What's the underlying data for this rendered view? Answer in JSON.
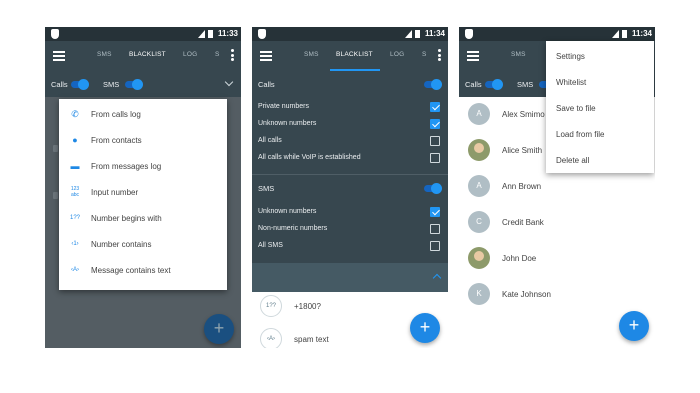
{
  "status": {
    "time1": "11:33",
    "time2": "11:34",
    "time3": "11:34"
  },
  "tabs": {
    "sms": "SMS",
    "blacklist": "BLACKLIST",
    "log": "LOG",
    "s": "S"
  },
  "subbar": {
    "calls": "Calls",
    "sms": "SMS"
  },
  "add_menu": {
    "items": [
      {
        "label": "From calls log",
        "icon": "phone-icon"
      },
      {
        "label": "From contacts",
        "icon": "person-icon"
      },
      {
        "label": "From messages log",
        "icon": "message-icon"
      },
      {
        "label": "Input number",
        "icon": "dialpad-123-icon",
        "glyph": "123\nabc"
      },
      {
        "label": "Number begins with",
        "icon": "number-begins-icon",
        "glyph": "1??"
      },
      {
        "label": "Number contains",
        "icon": "number-contains-icon",
        "glyph": "‹1›"
      },
      {
        "label": "Message contains text",
        "icon": "text-contains-icon",
        "glyph": "‹A›"
      }
    ]
  },
  "settings_panel": {
    "calls_header": "Calls",
    "calls_options": [
      {
        "label": "Private numbers",
        "checked": true
      },
      {
        "label": "Unknown numbers",
        "checked": true
      },
      {
        "label": "All calls",
        "checked": false
      },
      {
        "label": "All calls while VoIP is established",
        "checked": false
      }
    ],
    "sms_header": "SMS",
    "sms_options": [
      {
        "label": "Unknown numbers",
        "checked": true
      },
      {
        "label": "Non-numeric numbers",
        "checked": false
      },
      {
        "label": "All SMS",
        "checked": false
      }
    ]
  },
  "blacklist_entries": [
    {
      "icon_text": "1??",
      "text": "+1800?"
    },
    {
      "icon_text": "‹A›",
      "text": "spam text"
    }
  ],
  "contacts": [
    {
      "initial": "A",
      "name": "Alex Smimo",
      "photo": false
    },
    {
      "initial": "",
      "name": "Alice Smith",
      "photo": true
    },
    {
      "initial": "A",
      "name": "Ann Brown",
      "photo": false
    },
    {
      "initial": "C",
      "name": "Credit Bank",
      "photo": false
    },
    {
      "initial": "",
      "name": "John Doe",
      "photo": true
    },
    {
      "initial": "K",
      "name": "Kate Johnson",
      "photo": false
    }
  ],
  "overflow_menu": {
    "items": [
      "Settings",
      "Whitelist",
      "Save to file",
      "Load from file",
      "Delete all"
    ]
  },
  "fab_label": "+",
  "colors": {
    "accent": "#2196f3",
    "toolbar": "#37474f",
    "statusbar": "#263238"
  }
}
